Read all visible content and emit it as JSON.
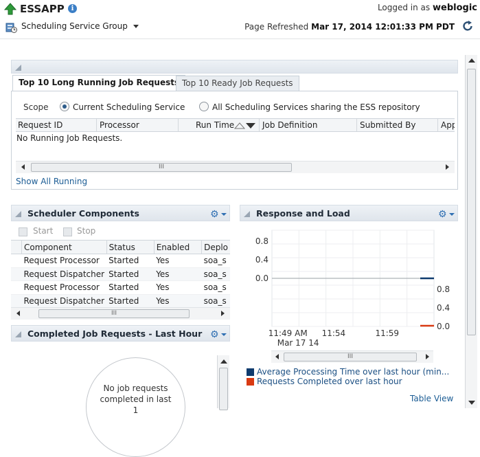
{
  "header": {
    "app_title": "ESSAPP",
    "logged_in_prefix": "Logged in as",
    "user": "weblogic",
    "target_menu": "Scheduling Service Group",
    "page_refreshed_label": "Page Refreshed",
    "page_refreshed_time": "Mar 17, 2014 12:01:33 PM PDT"
  },
  "long_running": {
    "tabs": [
      "Top 10 Long Running Job Requests",
      "Top 10 Ready Job Requests"
    ],
    "scope_label": "Scope",
    "scope_options": [
      "Current Scheduling Service",
      "All Scheduling Services sharing the ESS repository"
    ],
    "scope_selected": "Current Scheduling Service",
    "columns": [
      "Request ID",
      "Processor",
      "Run Time",
      "Job Definition",
      "Submitted By",
      "App"
    ],
    "empty_text": "No Running Job Requests.",
    "scroll_thumb": "III",
    "show_all_link": "Show All Running"
  },
  "scheduler_components": {
    "title": "Scheduler Components",
    "toolbar": {
      "start": "Start",
      "stop": "Stop"
    },
    "columns": [
      "Component",
      "Status",
      "Enabled",
      "Deplo"
    ],
    "rows": [
      [
        "Request Processor",
        "Started",
        "Yes",
        "soa_s"
      ],
      [
        "Request Dispatcher",
        "Started",
        "Yes",
        "soa_s"
      ],
      [
        "Request Processor",
        "Started",
        "Yes",
        "soa_s"
      ],
      [
        "Request Dispatcher",
        "Started",
        "Yes",
        "soa_s"
      ]
    ],
    "scroll_thumb": "III"
  },
  "completed_jobs": {
    "title": "Completed Job Requests - Last Hour",
    "empty_line1": "No job requests",
    "empty_line2": "completed in last 1"
  },
  "response_load": {
    "title": "Response and Load",
    "scroll_thumb": "III",
    "table_view_link": "Table View"
  },
  "colors": {
    "avg_processing": "#0f3b6e",
    "requests_completed": "#d93a12",
    "accent": "#2f6fb2"
  },
  "chart_data": {
    "type": "line",
    "x_ticks": [
      "11:49 AM",
      "11:54",
      "11:59"
    ],
    "x_subtick": "Mar 17 14",
    "y_left_ticks": [
      "0.8",
      "0.4",
      "0.0"
    ],
    "y_right_ticks": [
      "0.8",
      "0.4",
      "0.0"
    ],
    "series": [
      {
        "name": "Average Processing Time over last hour (min...",
        "axis": "left",
        "values": [
          0.0
        ],
        "color": "#0f3b6e"
      },
      {
        "name": "Requests Completed over last hour",
        "axis": "right",
        "values": [
          0.0
        ],
        "color": "#d93a12"
      }
    ],
    "y_left_range": [
      0,
      0.8
    ],
    "y_right_range": [
      0,
      0.8
    ],
    "grid": true
  }
}
